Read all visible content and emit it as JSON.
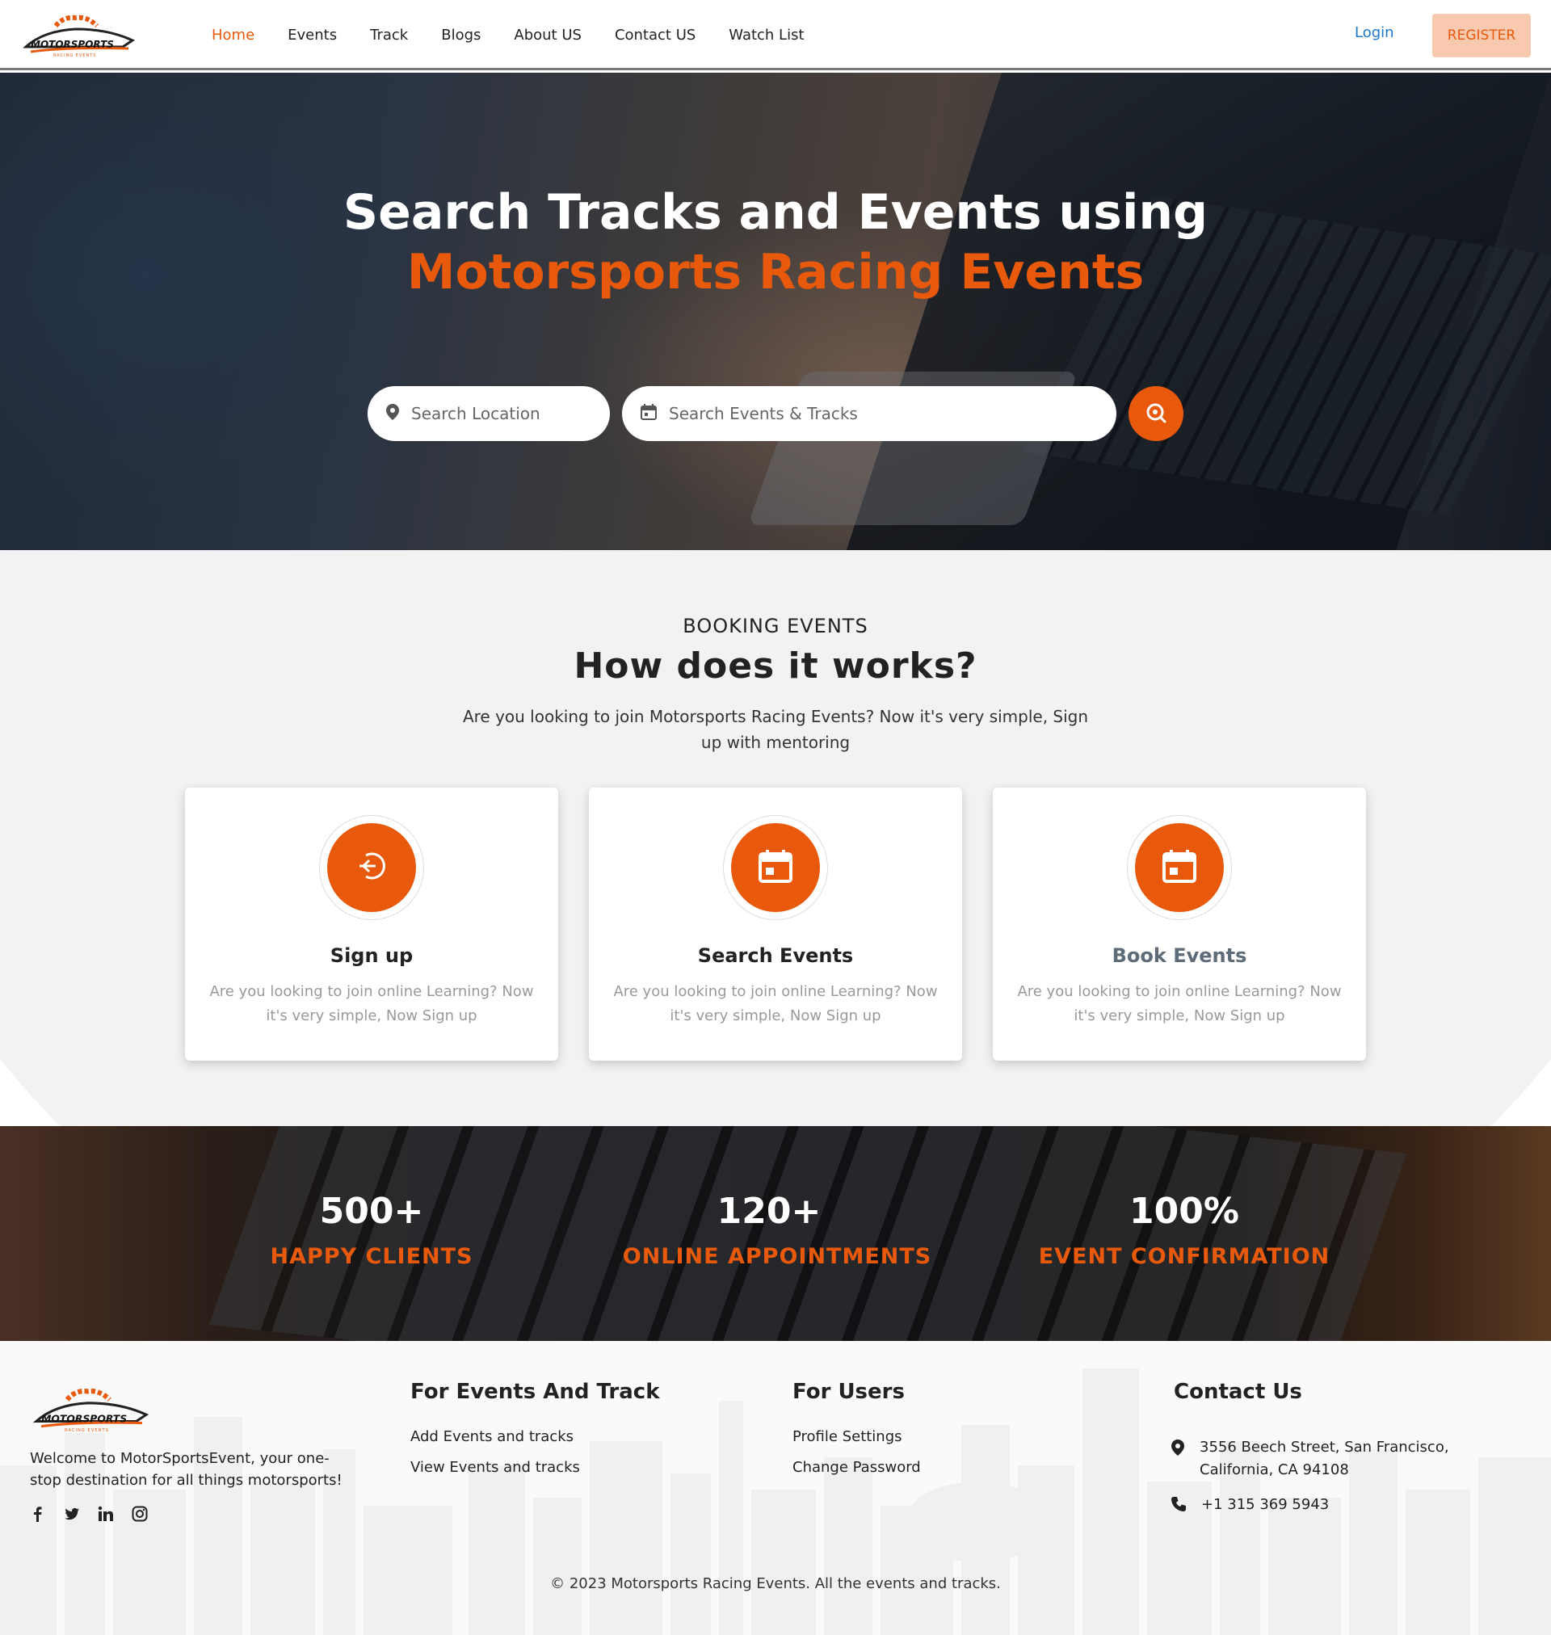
{
  "brand": {
    "accent": "#e8590c",
    "logo_text": "MOTORSPORTS",
    "logo_subtext": "RACING EVENTS"
  },
  "nav": {
    "items": [
      {
        "label": "Home",
        "active": true
      },
      {
        "label": "Events",
        "active": false
      },
      {
        "label": "Track",
        "active": false
      },
      {
        "label": "Blogs",
        "active": false
      },
      {
        "label": "About US",
        "active": false
      },
      {
        "label": "Contact US",
        "active": false
      },
      {
        "label": "Watch List",
        "active": false
      }
    ],
    "login": "Login",
    "register": "REGISTER"
  },
  "hero": {
    "title_line1": "Search Tracks and Events using",
    "title_line2": "Motorsports Racing Events",
    "location_placeholder": "Search Location",
    "events_placeholder": "Search Events & Tracks"
  },
  "how": {
    "eyebrow": "BOOKING EVENTS",
    "title": "How does it works?",
    "description": "Are you looking to join Motorsports Racing Events? Now it's very simple, Sign up with mentoring",
    "cards": [
      {
        "icon": "sign-in-icon",
        "title": "Sign up",
        "text": "Are you looking to join online Learning? Now it's very simple, Now Sign up",
        "title_color": "#222222"
      },
      {
        "icon": "calendar-icon",
        "title": "Search Events",
        "text": "Are you looking to join online Learning? Now it's very simple, Now Sign up",
        "title_color": "#222222"
      },
      {
        "icon": "calendar-icon",
        "title": "Book Events",
        "text": "Are you looking to join online Learning? Now it's very simple, Now Sign up",
        "title_color": "#5e6b78"
      }
    ]
  },
  "stats": [
    {
      "value": "500+",
      "label": "HAPPY CLIENTS"
    },
    {
      "value": "120+",
      "label": "ONLINE APPOINTMENTS"
    },
    {
      "value": "100%",
      "label": "EVENT CONFIRMATION"
    }
  ],
  "footer": {
    "about": "Welcome to MotorSportsEvent, your one-stop destination for all things motorsports!",
    "socials": [
      "facebook-icon",
      "twitter-icon",
      "linkedin-icon",
      "instagram-icon"
    ],
    "col_events": {
      "title": "For Events And Track",
      "links": [
        "Add Events and tracks",
        "View Events and tracks"
      ]
    },
    "col_users": {
      "title": "For Users",
      "links": [
        "Profile Settings",
        "Change Password"
      ]
    },
    "contact": {
      "title": "Contact Us",
      "address": "3556 Beech Street, San Francisco, California, CA 94108",
      "phone": "+1 315 369 5943"
    },
    "copyright": "© 2023 Motorsports Racing Events. All the events and tracks."
  }
}
